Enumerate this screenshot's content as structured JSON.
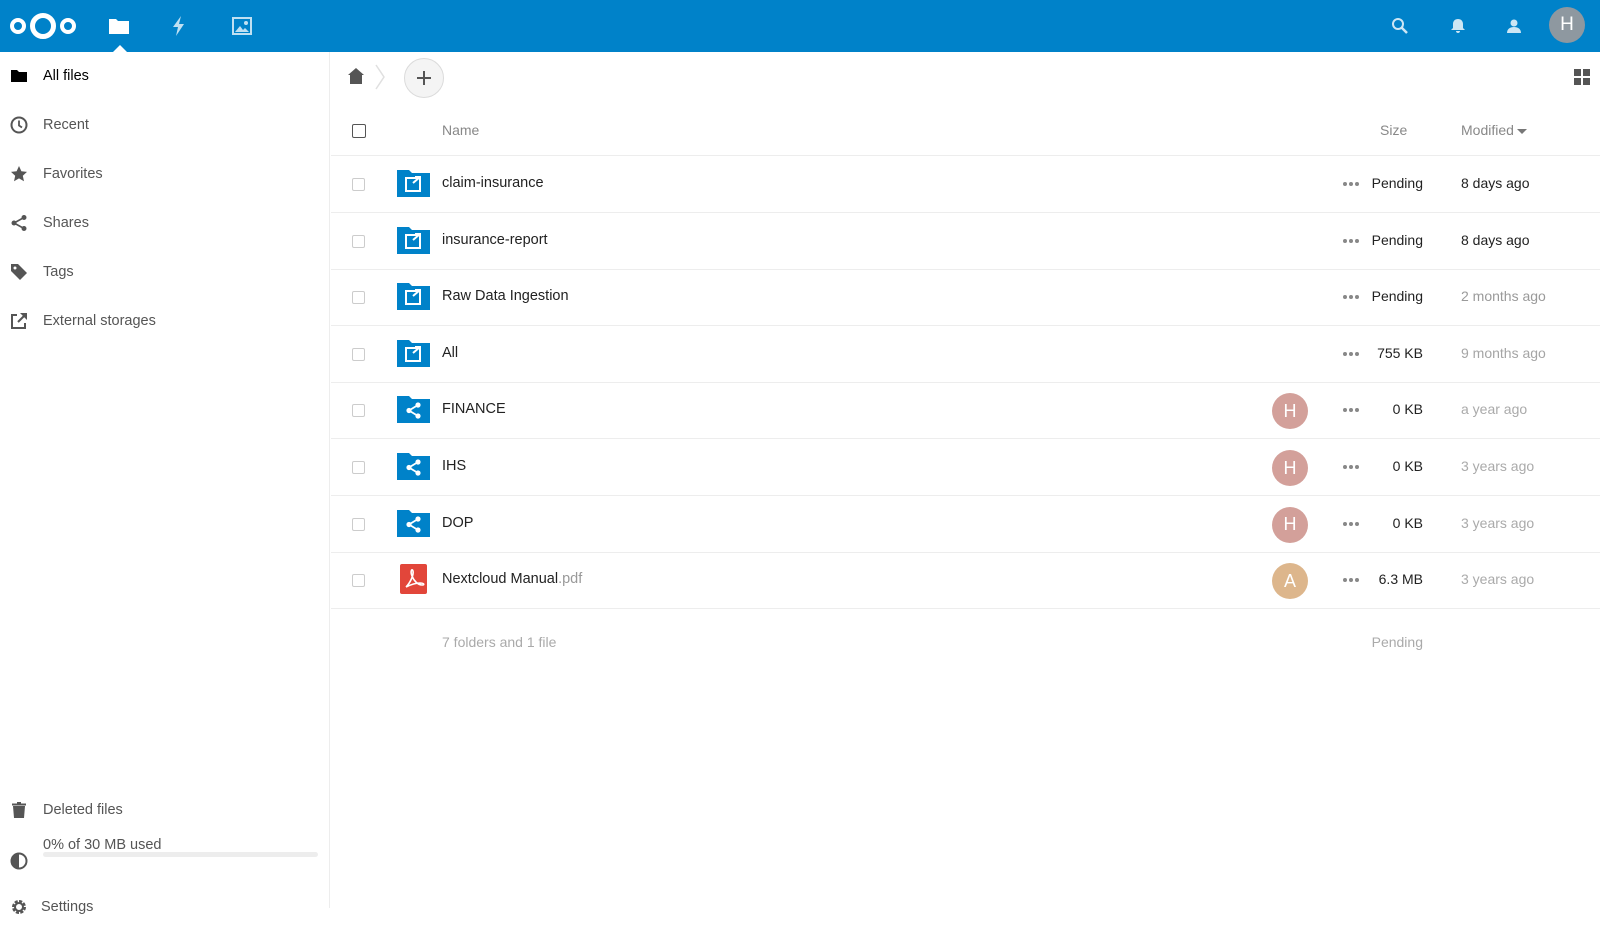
{
  "header": {
    "apps": [
      "files-icon",
      "activity-icon",
      "gallery-icon"
    ],
    "user_initial": "H",
    "colors": {
      "brand": "#0082c9"
    }
  },
  "sidebar": {
    "items": [
      {
        "label": "All files",
        "icon": "folder-icon"
      },
      {
        "label": "Recent",
        "icon": "clock-icon"
      },
      {
        "label": "Favorites",
        "icon": "star-icon"
      },
      {
        "label": "Shares",
        "icon": "share-icon"
      },
      {
        "label": "Tags",
        "icon": "tag-icon"
      },
      {
        "label": "External storages",
        "icon": "external-icon"
      }
    ],
    "deleted_files": "Deleted files",
    "quota": "0% of 30 MB used",
    "quota_fraction": 0,
    "settings": "Settings"
  },
  "table": {
    "col_name": "Name",
    "col_size": "Size",
    "col_modified": "Modified",
    "rows": [
      {
        "name": "claim-insurance",
        "ext": "",
        "type": "external-folder",
        "size": "Pending",
        "modified": "8 days ago",
        "mod_color": "#222"
      },
      {
        "name": "insurance-report",
        "ext": "",
        "type": "external-folder",
        "size": "Pending",
        "modified": "8 days ago",
        "mod_color": "#222"
      },
      {
        "name": "Raw Data Ingestion",
        "ext": "",
        "type": "external-folder",
        "size": "Pending",
        "modified": "2 months ago",
        "mod_color": "#9a9a9a"
      },
      {
        "name": "All",
        "ext": "",
        "type": "external-folder",
        "size": "755 KB",
        "modified": "9 months ago",
        "mod_color": "#a5a5a5"
      },
      {
        "name": "FINANCE",
        "ext": "",
        "type": "shared-folder",
        "avatar": "H",
        "avatar_color": "#d3a09a",
        "size": "0 KB",
        "modified": "a year ago",
        "mod_color": "#aaaaaa"
      },
      {
        "name": "IHS",
        "ext": "",
        "type": "shared-folder",
        "avatar": "H",
        "avatar_color": "#d3a09a",
        "size": "0 KB",
        "modified": "3 years ago",
        "mod_color": "#aaaaaa"
      },
      {
        "name": "DOP",
        "ext": "",
        "type": "shared-folder",
        "avatar": "H",
        "avatar_color": "#d3a09a",
        "size": "0 KB",
        "modified": "3 years ago",
        "mod_color": "#aaaaaa"
      },
      {
        "name": "Nextcloud Manual",
        "ext": ".pdf",
        "type": "pdf",
        "avatar": "A",
        "avatar_color": "#ddb68c",
        "size": "6.3 MB",
        "modified": "3 years ago",
        "mod_color": "#aaaaaa"
      }
    ],
    "summary": "7 folders and 1 file",
    "summary_size": "Pending"
  }
}
